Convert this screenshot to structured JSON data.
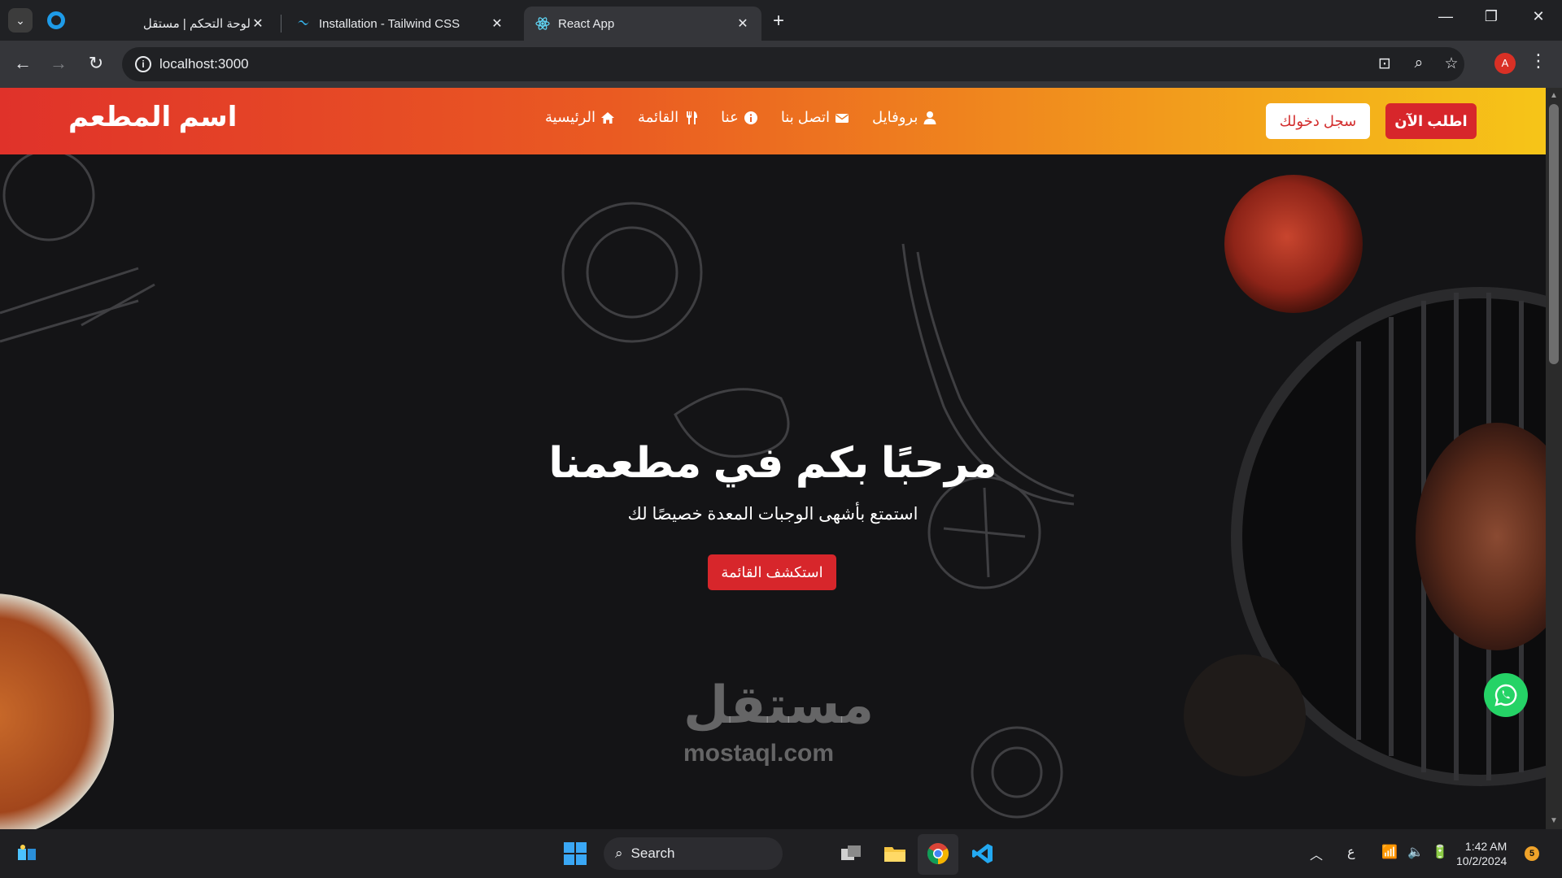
{
  "browser": {
    "tabs": [
      {
        "title": "لوحة التحكم | مستقل",
        "active": false
      },
      {
        "title": "Installation - Tailwind CSS",
        "active": false
      },
      {
        "title": "React App",
        "active": true
      }
    ],
    "url": "localhost:3000",
    "profile_initial": "A"
  },
  "site": {
    "brand": "اسم المطعم",
    "nav": [
      {
        "label": "الرئيسية",
        "icon": "home-icon"
      },
      {
        "label": "القائمة",
        "icon": "utensils-icon"
      },
      {
        "label": "عنا",
        "icon": "info-icon"
      },
      {
        "label": "اتصل بنا",
        "icon": "envelope-icon"
      },
      {
        "label": "بروفايل",
        "icon": "user-icon"
      }
    ],
    "login_label": "سجل دخولك",
    "order_label": "اطلب الآن",
    "colors": {
      "header_start": "#e0322a",
      "header_end": "#f6c518",
      "accent_red": "#d7262b",
      "whatsapp": "#25d366"
    }
  },
  "hero": {
    "title": "مرحبًا بكم في مطعمنا",
    "subtitle": "استمتع بأشهى الوجبات المعدة خصيصًا لك",
    "cta_label": "استكشف القائمة"
  },
  "watermark": {
    "arabic": "مستقل",
    "latin": "mostaql.com"
  },
  "taskbar": {
    "search_label": "Search",
    "input_indicator": "ع",
    "time": "1:42 AM",
    "date": "10/2/2024",
    "notification_count": "5"
  }
}
